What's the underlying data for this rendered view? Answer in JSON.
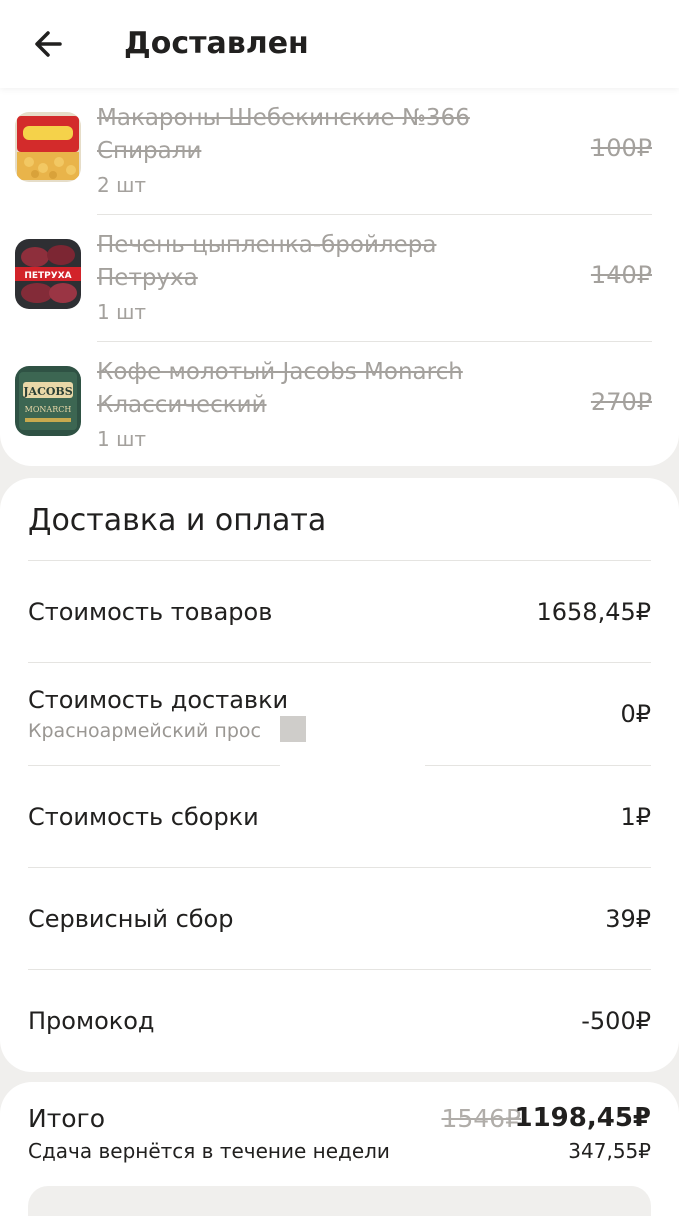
{
  "header": {
    "title": "Доставлен"
  },
  "items": [
    {
      "name": "Макароны Шебекинские №366 Спирали",
      "qty": "2 шт",
      "price": "100₽",
      "icon": "pasta-package-icon"
    },
    {
      "name": "Печень цыпленка-бройлера Петруха",
      "qty": "1 шт",
      "price": "140₽",
      "icon": "chicken-liver-package-icon",
      "brand_text": "ПЕТРУХА"
    },
    {
      "name": "Кофе молотый Jacobs Monarch Классический",
      "qty": "1 шт",
      "price": "270₽",
      "icon": "coffee-package-icon",
      "brand_text": "JACOBS",
      "brand_sub": "MONARCH"
    }
  ],
  "payment": {
    "title": "Доставка и оплата",
    "rows": [
      {
        "label": "Стоимость товаров",
        "value": "1658,45₽"
      },
      {
        "label": "Стоимость доставки",
        "sub": "Красноармейский прос",
        "value": "0₽"
      },
      {
        "label": "Стоимость сборки",
        "value": "1₽"
      },
      {
        "label": "Сервисный сбор",
        "value": "39₽"
      },
      {
        "label": "Промокод",
        "value": "-500₽"
      }
    ]
  },
  "total": {
    "label": "Итого",
    "old": "1546₽",
    "new": "1198,45₽",
    "change_text": "Сдача вернётся в течение недели",
    "change_value": "347,55₽"
  },
  "colors": {
    "background": "#f0efed",
    "card": "#ffffff",
    "text": "#21201f",
    "muted": "#a4a19d"
  }
}
